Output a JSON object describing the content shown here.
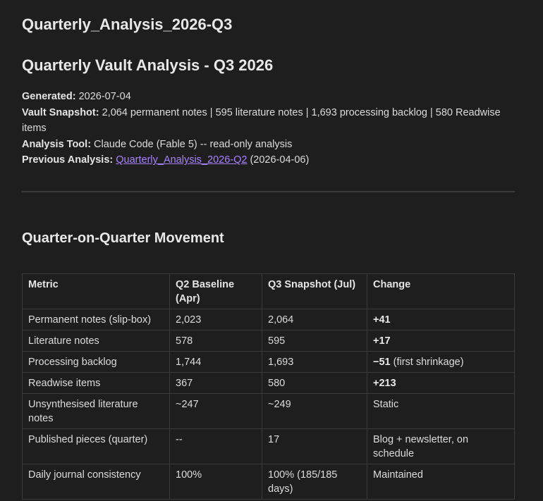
{
  "note": {
    "title": "Quarterly_Analysis_2026-Q3"
  },
  "doc": {
    "heading": "Quarterly Vault Analysis - Q3 2026"
  },
  "meta": {
    "generated_label": "Generated:",
    "generated_value": " 2026-07-04",
    "snapshot_label": "Vault Snapshot:",
    "snapshot_value": " 2,064 permanent notes | 595 literature notes | 1,693 processing backlog | 580 Readwise items",
    "tool_label": "Analysis Tool:",
    "tool_value": " Claude Code (Fable 5) -- read-only analysis",
    "previous_label": "Previous Analysis:",
    "previous_link": "Quarterly_Analysis_2026-Q2",
    "previous_date": " (2026-04-06)"
  },
  "section": {
    "heading": "Quarter-on-Quarter Movement"
  },
  "table": {
    "headers": [
      "Metric",
      "Q2 Baseline (Apr)",
      "Q3 Snapshot (Jul)",
      "Change"
    ],
    "rows": [
      {
        "metric": "Permanent notes (slip-box)",
        "q2": "2,023",
        "q3": "2,064",
        "change_bold": "+41",
        "change_rest": ""
      },
      {
        "metric": "Literature notes",
        "q2": "578",
        "q3": "595",
        "change_bold": "+17",
        "change_rest": ""
      },
      {
        "metric": "Processing backlog",
        "q2": "1,744",
        "q3": "1,693",
        "change_bold": "−51",
        "change_rest": " (first shrinkage)"
      },
      {
        "metric": "Readwise items",
        "q2": "367",
        "q3": "580",
        "change_bold": "+213",
        "change_rest": ""
      },
      {
        "metric": "Unsynthesised literature notes",
        "q2": "~247",
        "q3": "~249",
        "change_bold": "",
        "change_rest": "Static"
      },
      {
        "metric": "Published pieces (quarter)",
        "q2": "--",
        "q3": "17",
        "change_bold": "",
        "change_rest": "Blog + newsletter, on schedule"
      },
      {
        "metric": "Daily journal consistency",
        "q2": "100%",
        "q3": "100% (185/185 days)",
        "change_bold": "",
        "change_rest": "Maintained"
      }
    ]
  },
  "colors": {
    "background": "#1e1e1e",
    "text": "#dcdcdc",
    "link": "#a882ff",
    "border": "#3a3a3a"
  }
}
